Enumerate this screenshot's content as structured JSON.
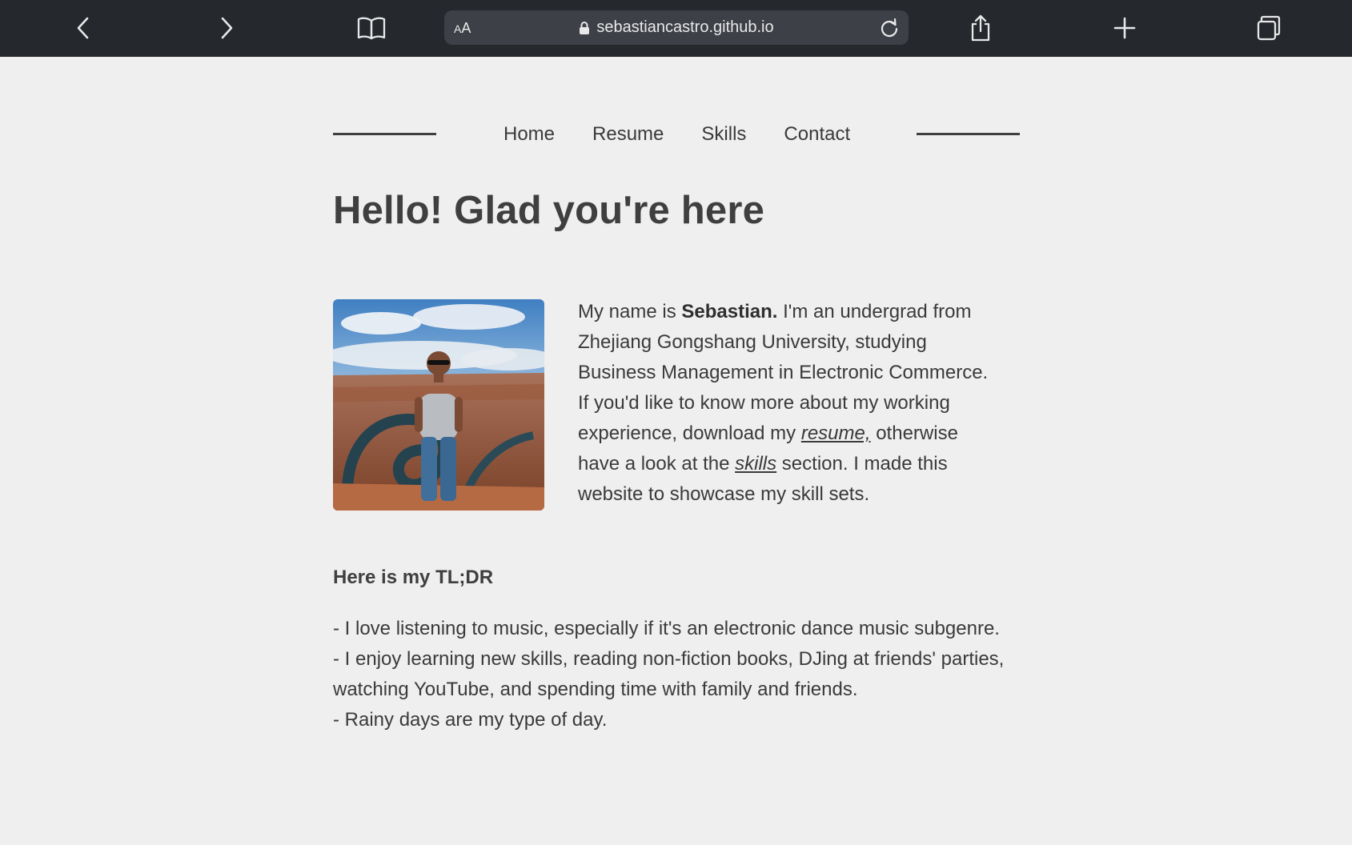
{
  "browser": {
    "url_text": "sebastiancastro.github.io",
    "reader_label_small": "A",
    "reader_label_big": "A",
    "icons": [
      "back-chevron-icon",
      "forward-chevron-icon",
      "bookmarks-book-icon",
      "lock-icon",
      "reload-icon",
      "share-icon",
      "new-tab-plus-icon",
      "tabs-overview-icon"
    ]
  },
  "nav": {
    "links": [
      "Home",
      "Resume",
      "Skills",
      "Contact"
    ]
  },
  "page": {
    "title": "Hello! Glad you're here",
    "intro": {
      "prefix": "My name is ",
      "name": "Sebastian.",
      "part1": " I'm an undergrad from Zhejiang Gongshang University, studying Business Management in Electronic Commerce. If you'd like to know more about my working experience, download my ",
      "resume_link": "resume,",
      "part2": " otherwise have a look at the ",
      "skills_link": "skills",
      "part3": " section. I made this website to showcase my skill sets."
    },
    "tldr_heading": "Here is my TL;DR",
    "tldr_items": [
      "- I love listening to music, especially if it's an electronic dance music subgenre.",
      "- I enjoy learning new skills, reading non-fiction books, DJing at friends' parties, watching YouTube, and spending time with family and friends.",
      "- Rainy days are my type of day."
    ]
  },
  "colors": {
    "toolbar_bg": "#25282d",
    "urlbar_bg": "#3d4046",
    "page_bg": "#efefef",
    "text": "#3f3f3f"
  }
}
